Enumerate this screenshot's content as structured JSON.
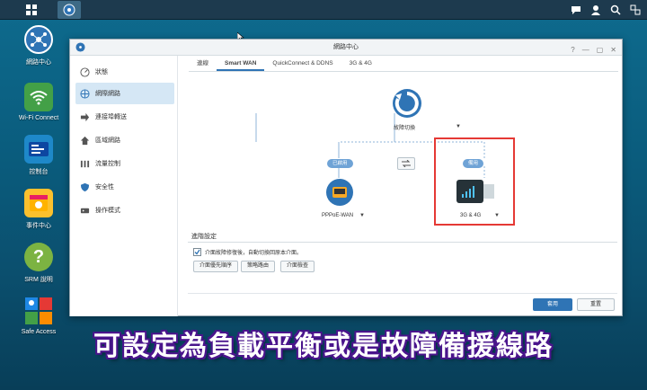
{
  "taskbar": {
    "icons": [
      "apps-grid-icon",
      "network-center-icon",
      "chat-icon",
      "user-icon",
      "search-icon",
      "windows-icon"
    ]
  },
  "desktop": {
    "icons": [
      {
        "label": "網路中心",
        "icon": "network-center-icon"
      },
      {
        "label": "Wi-Fi Connect",
        "icon": "wifi-icon"
      },
      {
        "label": "控制台",
        "icon": "control-panel-icon"
      },
      {
        "label": "事件中心",
        "icon": "event-center-icon"
      },
      {
        "label": "SRM 說明",
        "icon": "help-icon"
      },
      {
        "label": "Safe Access",
        "icon": "safe-access-icon"
      }
    ]
  },
  "window": {
    "title": "網路中心",
    "controls": [
      "?",
      "—",
      "▢",
      "✕"
    ]
  },
  "sidebar": {
    "items": [
      {
        "label": "狀態",
        "icon": "status-icon"
      },
      {
        "label": "網際網路",
        "icon": "internet-icon"
      },
      {
        "label": "連接埠轉送",
        "icon": "port-forward-icon"
      },
      {
        "label": "區域網路",
        "icon": "local-network-icon"
      },
      {
        "label": "流量控制",
        "icon": "traffic-control-icon"
      },
      {
        "label": "安全性",
        "icon": "security-icon"
      },
      {
        "label": "操作模式",
        "icon": "operation-mode-icon"
      }
    ]
  },
  "tabs": [
    "連線",
    "Smart WAN",
    "QuickConnect & DDNS",
    "3G & 4G"
  ],
  "diagram": {
    "top_node": "故障切換",
    "left_status": "已啟用",
    "right_status": "備用",
    "left_node": "PPPoE-WAN",
    "right_node": "3G & 4G"
  },
  "advanced": {
    "title": "進階設定",
    "checkbox_label": "介面故障修復後，自動切換回原本介面。",
    "buttons": [
      "介面優先順序",
      "策略路由",
      "介面檢查"
    ]
  },
  "footer": {
    "apply": "套用",
    "reset": "重置"
  },
  "caption": "可設定為負載平衡或是故障備援線路",
  "colors": {
    "accent": "#2f74b5",
    "highlight": "#e53935",
    "caption_outline": "#4a148c"
  }
}
